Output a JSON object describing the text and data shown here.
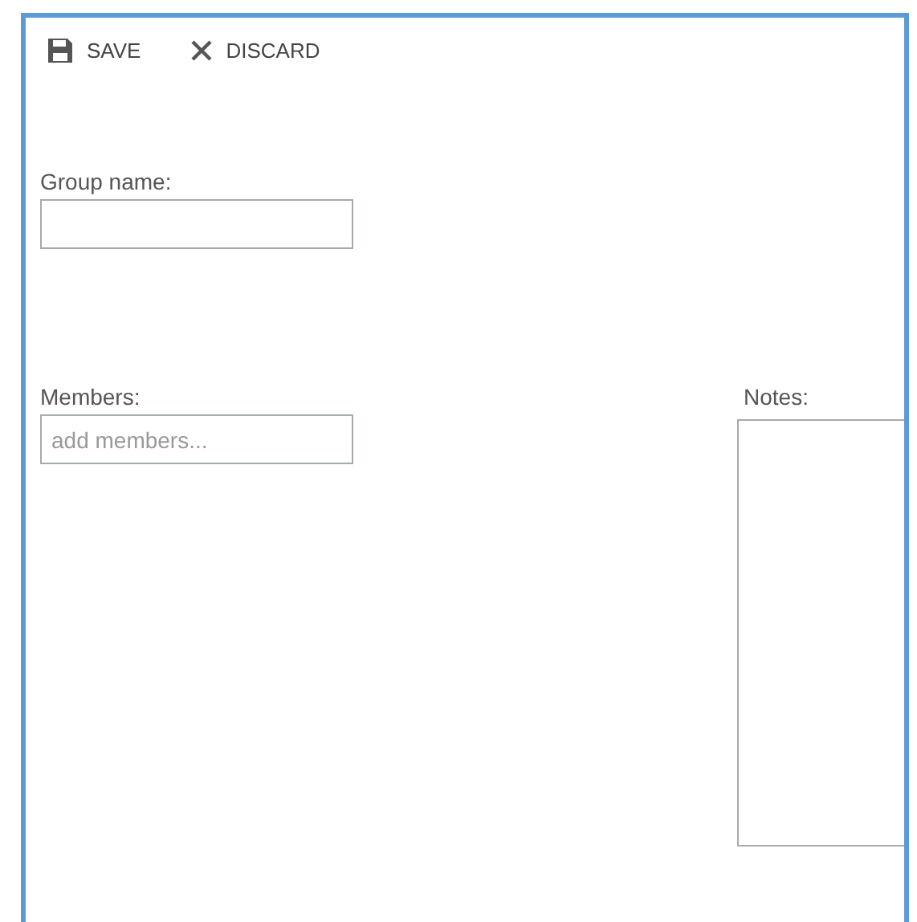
{
  "toolbar": [
    {
      "kind": "save",
      "label": "SAVE"
    },
    {
      "kind": "discard",
      "label": "DISCARD"
    }
  ],
  "group_name": {
    "label": "Group name:"
  },
  "members": {
    "label": "Members:",
    "placeholder": "add members..."
  },
  "notes": {
    "label": "Notes:"
  }
}
